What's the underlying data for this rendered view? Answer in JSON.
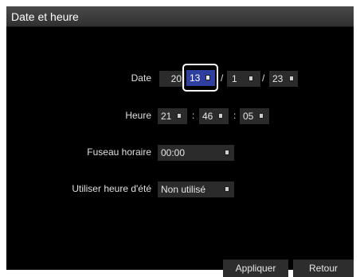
{
  "window": {
    "title": "Date et heure"
  },
  "date": {
    "label": "Date",
    "year_prefix": "20",
    "year_suffix": "13",
    "month": "1",
    "day": "23",
    "separator": "/"
  },
  "time": {
    "label": "Heure",
    "hour": "21",
    "minute": "46",
    "second": "05",
    "separator": ":"
  },
  "timezone": {
    "label": "Fuseau horaire",
    "value": "00:00"
  },
  "dst": {
    "label": "Utiliser heure d'été",
    "value": "Non utilisé"
  },
  "buttons": {
    "apply": "Appliquer",
    "back": "Retour"
  },
  "icons": {
    "spinner": "spin-arrow-icon"
  },
  "colors": {
    "selected": "#2f3fa0",
    "field_bg": "#2b2b2b",
    "window_bg": "#000000"
  }
}
